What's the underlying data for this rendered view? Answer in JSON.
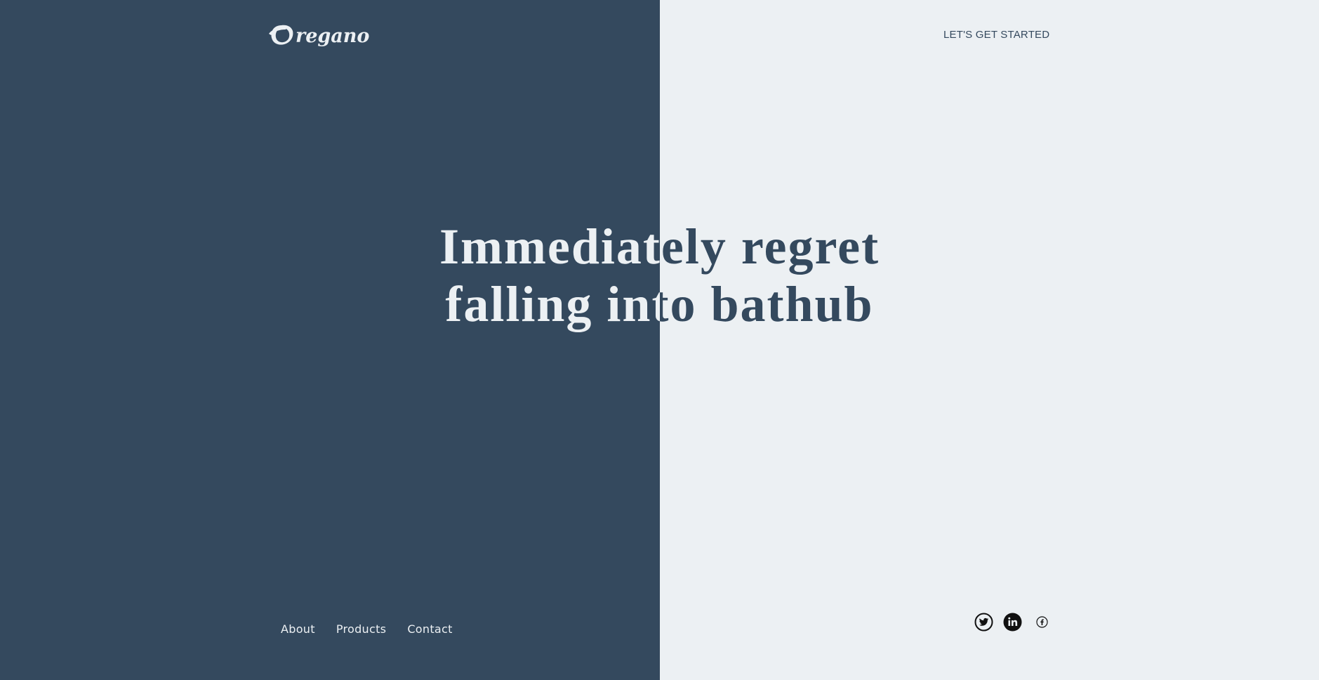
{
  "brand": {
    "logo_text": "Oregano",
    "colors": {
      "dark": "#34495e",
      "light": "#ecf0f3"
    }
  },
  "header": {
    "cta_label": "LET'S GET STARTED"
  },
  "hero": {
    "headline": "Immediately regret\nfalling into bathub"
  },
  "footer": {
    "nav": [
      {
        "label": "About"
      },
      {
        "label": "Products"
      },
      {
        "label": "Contact"
      }
    ],
    "social": [
      {
        "icon": "twitter-icon"
      },
      {
        "icon": "linkedin-icon"
      },
      {
        "icon": "facebook-icon"
      }
    ]
  }
}
